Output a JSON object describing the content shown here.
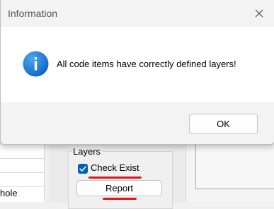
{
  "dialog": {
    "title": "Information",
    "message": "All code items have correctly defined layers!",
    "ok_label": "OK",
    "close_icon": "close-icon",
    "info_icon": "info-icon"
  },
  "background": {
    "partial_cell_text": "hole",
    "layers_group": {
      "label": "Layers",
      "check_exist_label": "Check Exist",
      "check_exist_checked": true,
      "report_label": "Report"
    }
  },
  "colors": {
    "info_blue": "#1a73d2",
    "checkbox_blue": "#005fb8",
    "annotation_red": "#e0141e",
    "dialog_footer": "#f3f3f3",
    "dialog_body": "#ffffff"
  }
}
